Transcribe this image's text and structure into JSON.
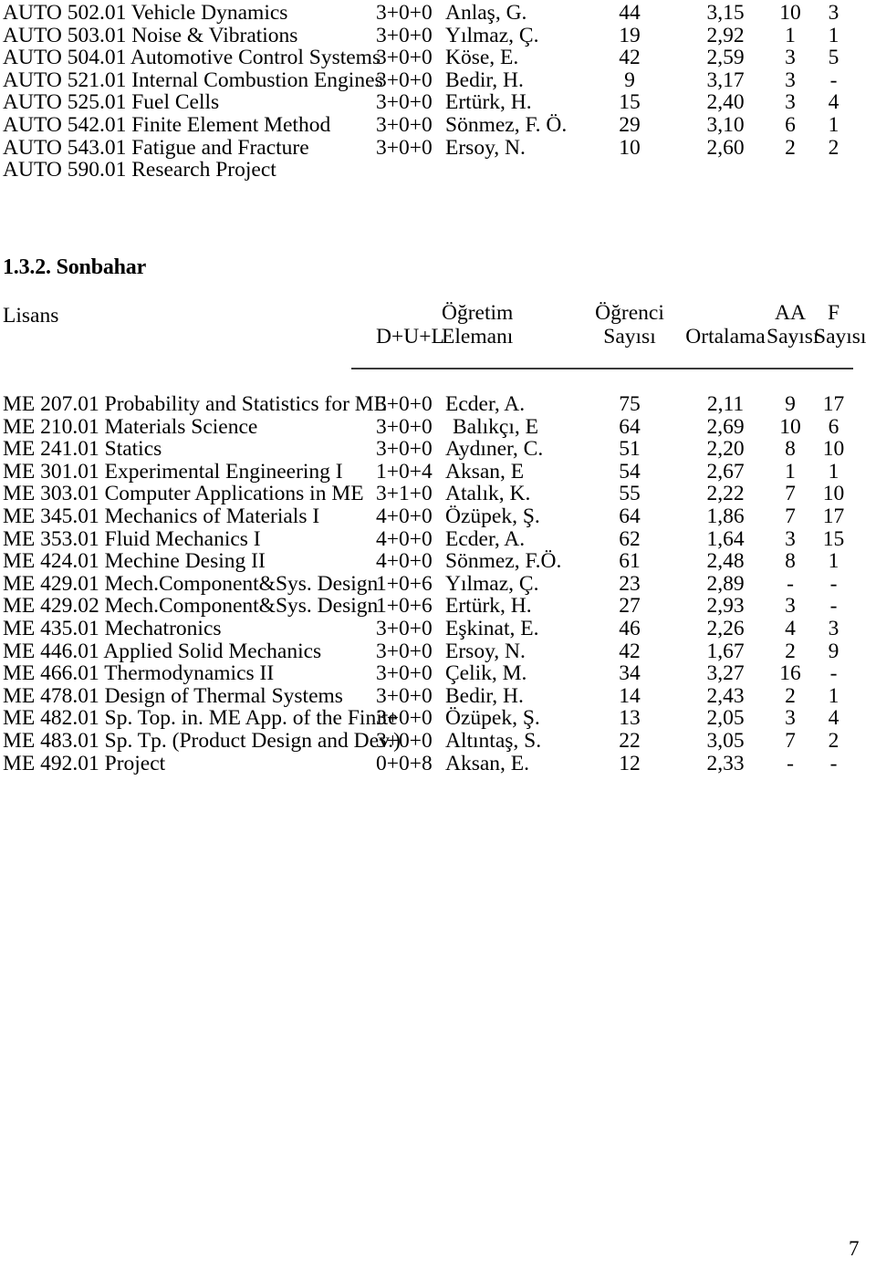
{
  "document": {
    "page_number": "7"
  },
  "graduate_table": {
    "rows": [
      {
        "code": "AUTO 502.01 Vehicle Dynamics",
        "dul": "3+0+0",
        "instructor": "Anlaş, G.",
        "students": "44",
        "average": "3,15",
        "aa": "10",
        "f": "3"
      },
      {
        "code": "AUTO 503.01 Noise & Vibrations",
        "dul": "3+0+0",
        "instructor": "Yılmaz, Ç.",
        "students": "19",
        "average": "2,92",
        "aa": "1",
        "f": "1"
      },
      {
        "code": "AUTO 504.01 Automotive Control Systems",
        "dul": "3+0+0",
        "instructor": "Köse, E.",
        "students": "42",
        "average": "2,59",
        "aa": "3",
        "f": "5"
      },
      {
        "code": "AUTO 521.01 Internal Combustion Engines",
        "dul": "3+0+0",
        "instructor": "Bedir, H.",
        "students": "9",
        "average": "3,17",
        "aa": "3",
        "f": "-"
      },
      {
        "code": "AUTO 525.01 Fuel Cells",
        "dul": "3+0+0",
        "instructor": "Ertürk, H.",
        "students": "15",
        "average": "2,40",
        "aa": "3",
        "f": "4"
      },
      {
        "code": "AUTO 542.01 Finite Element Method",
        "dul": "3+0+0",
        "instructor": "Sönmez, F. Ö.",
        "students": "29",
        "average": "3,10",
        "aa": "6",
        "f": "1"
      },
      {
        "code": "AUTO 543.01 Fatigue and Fracture",
        "dul": "3+0+0",
        "instructor": "Ersoy, N.",
        "students": "10",
        "average": "2,60",
        "aa": "2",
        "f": "2"
      },
      {
        "code": "AUTO 590.01 Research Project",
        "dul": "",
        "instructor": "",
        "students": "",
        "average": "",
        "aa": "",
        "f": ""
      }
    ]
  },
  "section": {
    "heading": "1.3.2. Sonbahar",
    "level_label": "Lisans"
  },
  "table_header": {
    "line1": {
      "dul": "",
      "instructor": "Öğretim",
      "students": "Öğrenci",
      "average": "",
      "aa": "AA",
      "f": "F"
    },
    "line2": {
      "dul": "D+U+L",
      "instructor": "Elemanı",
      "students": "Sayısı",
      "average": "Ortalama",
      "aa": "Sayısı",
      "f": "Sayısı"
    }
  },
  "undergraduate_table": {
    "rows": [
      {
        "code": "ME 207.01 Probability and Statistics for ME",
        "dul": "3+0+0",
        "instructor": "Ecder, A.",
        "instructor_indent": false,
        "students": "75",
        "average": "2,11",
        "aa": "9",
        "f": "17"
      },
      {
        "code": "ME 210.01 Materials Science",
        "dul": "3+0+0",
        "instructor": "Balıkçı, E",
        "instructor_indent": true,
        "students": "64",
        "average": "2,69",
        "aa": "10",
        "f": "6"
      },
      {
        "code": "ME 241.01 Statics",
        "dul": "3+0+0",
        "instructor": "Aydıner, C.",
        "instructor_indent": false,
        "students": "51",
        "average": "2,20",
        "aa": "8",
        "f": "10"
      },
      {
        "code": "ME 301.01 Experimental Engineering I",
        "dul": "1+0+4",
        "instructor": "Aksan, E",
        "instructor_indent": false,
        "students": "54",
        "average": "2,67",
        "aa": "1",
        "f": "1"
      },
      {
        "code": "ME 303.01 Computer Applications in ME",
        "dul": "3+1+0",
        "instructor": "Atalık, K.",
        "instructor_indent": false,
        "students": "55",
        "average": "2,22",
        "aa": "7",
        "f": "10"
      },
      {
        "code": "ME 345.01 Mechanics of Materials I",
        "dul": "4+0+0",
        "instructor": "Özüpek, Ş.",
        "instructor_indent": false,
        "students": "64",
        "average": "1,86",
        "aa": "7",
        "f": "17"
      },
      {
        "code": "ME 353.01 Fluid Mechanics I",
        "dul": "4+0+0",
        "instructor": "Ecder, A.",
        "instructor_indent": false,
        "students": "62",
        "average": "1,64",
        "aa": "3",
        "f": "15"
      },
      {
        "code": "ME 424.01 Mechine Desing II",
        "dul": "4+0+0",
        "instructor": "Sönmez, F.Ö.",
        "instructor_indent": false,
        "students": "61",
        "average": "2,48",
        "aa": "8",
        "f": "1"
      },
      {
        "code": "ME 429.01 Mech.Component&Sys. Design",
        "dul": "1+0+6",
        "instructor": "Yılmaz, Ç.",
        "instructor_indent": false,
        "students": "23",
        "average": "2,89",
        "aa": "-",
        "f": "-"
      },
      {
        "code": "ME 429.02 Mech.Component&Sys. Design",
        "dul": "1+0+6",
        "instructor": "Ertürk, H.",
        "instructor_indent": false,
        "students": "27",
        "average": "2,93",
        "aa": "3",
        "f": "-"
      },
      {
        "code": "ME 435.01 Mechatronics",
        "dul": "3+0+0",
        "instructor": "Eşkinat, E.",
        "instructor_indent": false,
        "students": "46",
        "average": "2,26",
        "aa": "4",
        "f": "3"
      },
      {
        "code": "ME 446.01 Applied Solid Mechanics",
        "dul": "3+0+0",
        "instructor": "Ersoy, N.",
        "instructor_indent": false,
        "students": "42",
        "average": "1,67",
        "aa": "2",
        "f": "9"
      },
      {
        "code": "ME 466.01 Thermodynamics II",
        "dul": "3+0+0",
        "instructor": "Çelik, M.",
        "instructor_indent": false,
        "students": "34",
        "average": "3,27",
        "aa": "16",
        "f": "-"
      },
      {
        "code": "ME 478.01 Design of Thermal Systems",
        "dul": "3+0+0",
        "instructor": "Bedir, H.",
        "instructor_indent": false,
        "students": "14",
        "average": "2,43",
        "aa": "2",
        "f": "1"
      },
      {
        "code": "ME 482.01  Sp. Top. in. ME App. of the Finite",
        "dul": "3+0+0",
        "instructor": "Özüpek, Ş.",
        "instructor_indent": false,
        "students": "13",
        "average": "2,05",
        "aa": "3",
        "f": "4"
      },
      {
        "code": "ME 483.01 Sp. Tp. (Product Design and Dev.)",
        "dul": "3+0+0",
        "instructor": "Altıntaş, S.",
        "instructor_indent": false,
        "students": "22",
        "average": "3,05",
        "aa": "7",
        "f": "2"
      },
      {
        "code": "ME 492.01 Project",
        "dul": "0+0+8",
        "instructor": "Aksan, E.",
        "instructor_indent": false,
        "students": "12",
        "average": "2,33",
        "aa": "-",
        "f": "-"
      }
    ]
  }
}
